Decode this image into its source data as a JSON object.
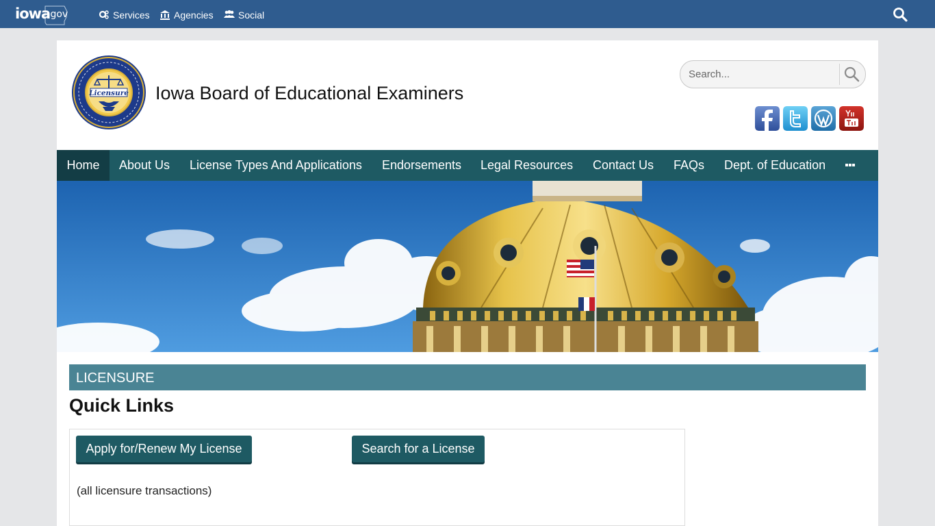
{
  "topbar": {
    "logo_text": "iowa",
    "logo_suffix": ".gov",
    "items": [
      {
        "label": "Services",
        "icon": "gears-icon"
      },
      {
        "label": "Agencies",
        "icon": "institution-icon"
      },
      {
        "label": "Social",
        "icon": "users-icon"
      }
    ],
    "search_icon": "search-icon"
  },
  "header": {
    "seal_text": "Licensure",
    "title": "Iowa Board of Educational Examiners",
    "search": {
      "placeholder": "Search..."
    },
    "social": [
      "facebook-icon",
      "twitter-icon",
      "wordpress-icon",
      "youtube-icon"
    ]
  },
  "nav": {
    "items": [
      {
        "label": "Home",
        "active": true
      },
      {
        "label": "About Us"
      },
      {
        "label": "License Types And Applications"
      },
      {
        "label": "Endorsements"
      },
      {
        "label": "Legal Resources"
      },
      {
        "label": "Contact Us"
      },
      {
        "label": "FAQs"
      },
      {
        "label": "Dept. of Education"
      }
    ],
    "more_icon": "ellipsis-icon"
  },
  "section": {
    "bar_label": "LICENSURE",
    "title": "Quick Links",
    "buttons": [
      {
        "label": "Apply for/Renew My License"
      },
      {
        "label": "Search for a License"
      }
    ],
    "note": "(all licensure transactions)"
  },
  "colors": {
    "topbar": "#2f5c8f",
    "nav": "#1e5a63",
    "nav_active": "#133d45",
    "section_bar": "#4a8494"
  }
}
